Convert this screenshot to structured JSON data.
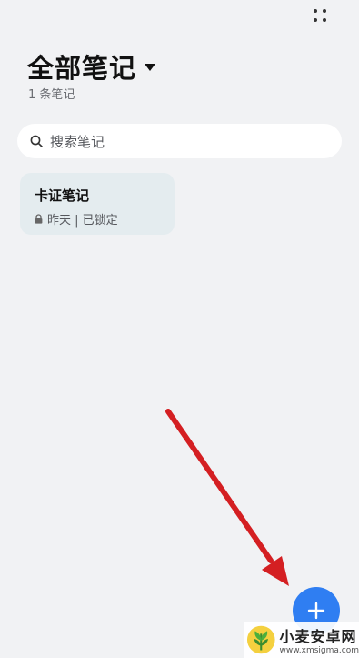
{
  "header": {
    "title": "全部笔记",
    "count": "1 条笔记"
  },
  "search": {
    "placeholder": "搜索笔记",
    "icon": "search-icon"
  },
  "notes": [
    {
      "title": "卡证笔记",
      "meta": "昨天 | 已锁定",
      "icon": "lock-icon"
    }
  ],
  "fab": {
    "icon": "plus-icon"
  },
  "annotation": {
    "color": "#d41f22"
  },
  "watermark": {
    "name": "小麦安卓网",
    "url": "www.xmsigma.com"
  },
  "colors": {
    "background": "#f1f2f4",
    "accent": "#2f7ef2",
    "card": "#e4ecef"
  }
}
